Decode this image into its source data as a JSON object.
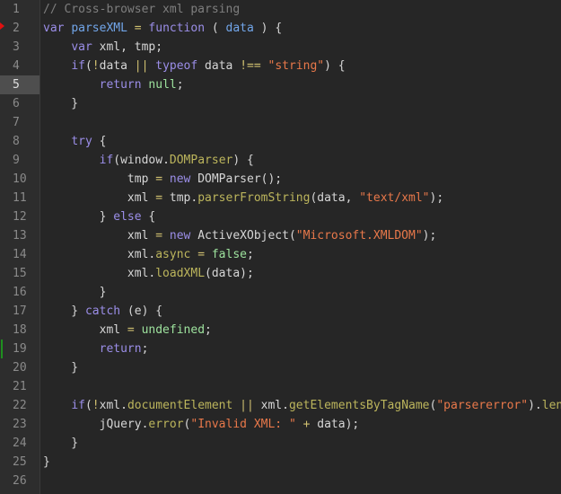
{
  "editor": {
    "active_line": 5,
    "breakpoint_line": 2,
    "modified_lines": [
      19
    ],
    "colors": {
      "background": "#262626",
      "gutter": "#2d2d2d",
      "keyword": "#9b8ee8",
      "string": "#e8784a",
      "literal": "#9ee39e",
      "comment": "#7e7e7e"
    },
    "lines": [
      [
        [
          "cm",
          "// Cross-browser xml parsing"
        ]
      ],
      [
        [
          "kw",
          "var"
        ],
        [
          "tx",
          " "
        ],
        [
          "id",
          "parseXML"
        ],
        [
          "tx",
          " "
        ],
        [
          "op",
          "="
        ],
        [
          "tx",
          " "
        ],
        [
          "kw",
          "function"
        ],
        [
          "tx",
          " ( "
        ],
        [
          "id",
          "data"
        ],
        [
          "tx",
          " ) {"
        ]
      ],
      [
        [
          "tx",
          "    "
        ],
        [
          "kw",
          "var"
        ],
        [
          "tx",
          " xml, tmp;"
        ]
      ],
      [
        [
          "tx",
          "    "
        ],
        [
          "kw",
          "if"
        ],
        [
          "tx",
          "("
        ],
        [
          "op",
          "!"
        ],
        [
          "tx",
          "data "
        ],
        [
          "op",
          "||"
        ],
        [
          "tx",
          " "
        ],
        [
          "kw",
          "typeof"
        ],
        [
          "tx",
          " data "
        ],
        [
          "op",
          "!=="
        ],
        [
          "tx",
          " "
        ],
        [
          "str",
          "\"string\""
        ],
        [
          "tx",
          ") {"
        ]
      ],
      [
        [
          "tx",
          "        "
        ],
        [
          "kw",
          "return"
        ],
        [
          "tx",
          " "
        ],
        [
          "lit",
          "null"
        ],
        [
          "tx",
          ";"
        ]
      ],
      [
        [
          "tx",
          "    }"
        ]
      ],
      [],
      [
        [
          "tx",
          "    "
        ],
        [
          "kw",
          "try"
        ],
        [
          "tx",
          " {"
        ]
      ],
      [
        [
          "tx",
          "        "
        ],
        [
          "kw",
          "if"
        ],
        [
          "tx",
          "(window."
        ],
        [
          "prop",
          "DOMParser"
        ],
        [
          "tx",
          ") {"
        ]
      ],
      [
        [
          "tx",
          "            tmp "
        ],
        [
          "op",
          "="
        ],
        [
          "tx",
          " "
        ],
        [
          "kw",
          "new"
        ],
        [
          "tx",
          " DOMParser();"
        ]
      ],
      [
        [
          "tx",
          "            xml "
        ],
        [
          "op",
          "="
        ],
        [
          "tx",
          " tmp."
        ],
        [
          "prop",
          "parserFromString"
        ],
        [
          "tx",
          "(data, "
        ],
        [
          "str",
          "\"text/xml\""
        ],
        [
          "tx",
          ");"
        ]
      ],
      [
        [
          "tx",
          "        } "
        ],
        [
          "kw",
          "else"
        ],
        [
          "tx",
          " {"
        ]
      ],
      [
        [
          "tx",
          "            xml "
        ],
        [
          "op",
          "="
        ],
        [
          "tx",
          " "
        ],
        [
          "kw",
          "new"
        ],
        [
          "tx",
          " ActiveXObject("
        ],
        [
          "str",
          "\"Microsoft.XMLDOM\""
        ],
        [
          "tx",
          ");"
        ]
      ],
      [
        [
          "tx",
          "            xml."
        ],
        [
          "prop",
          "async"
        ],
        [
          "tx",
          " "
        ],
        [
          "op",
          "="
        ],
        [
          "tx",
          " "
        ],
        [
          "lit",
          "false"
        ],
        [
          "tx",
          ";"
        ]
      ],
      [
        [
          "tx",
          "            xml."
        ],
        [
          "prop",
          "loadXML"
        ],
        [
          "tx",
          "(data);"
        ]
      ],
      [
        [
          "tx",
          "        }"
        ]
      ],
      [
        [
          "tx",
          "    } "
        ],
        [
          "kw",
          "catch"
        ],
        [
          "tx",
          " (e) {"
        ]
      ],
      [
        [
          "tx",
          "        xml "
        ],
        [
          "op",
          "="
        ],
        [
          "tx",
          " "
        ],
        [
          "lit",
          "undefined"
        ],
        [
          "tx",
          ";"
        ]
      ],
      [
        [
          "tx",
          "        "
        ],
        [
          "kw",
          "return"
        ],
        [
          "tx",
          ";"
        ]
      ],
      [
        [
          "tx",
          "    }"
        ]
      ],
      [],
      [
        [
          "tx",
          "    "
        ],
        [
          "kw",
          "if"
        ],
        [
          "tx",
          "("
        ],
        [
          "op",
          "!"
        ],
        [
          "tx",
          "xml."
        ],
        [
          "prop",
          "documentElement"
        ],
        [
          "tx",
          " "
        ],
        [
          "op",
          "||"
        ],
        [
          "tx",
          " xml."
        ],
        [
          "prop",
          "getElementsByTagName"
        ],
        [
          "tx",
          "("
        ],
        [
          "str",
          "\"parsererror\""
        ],
        [
          "tx",
          ")."
        ],
        [
          "prop",
          "length"
        ],
        [
          "tx",
          ") {"
        ]
      ],
      [
        [
          "tx",
          "        jQuery."
        ],
        [
          "prop",
          "error"
        ],
        [
          "tx",
          "("
        ],
        [
          "str",
          "\"Invalid XML: \""
        ],
        [
          "tx",
          " "
        ],
        [
          "op",
          "+"
        ],
        [
          "tx",
          " data);"
        ]
      ],
      [
        [
          "tx",
          "    }"
        ]
      ],
      [
        [
          "tx",
          "}"
        ]
      ],
      []
    ]
  }
}
